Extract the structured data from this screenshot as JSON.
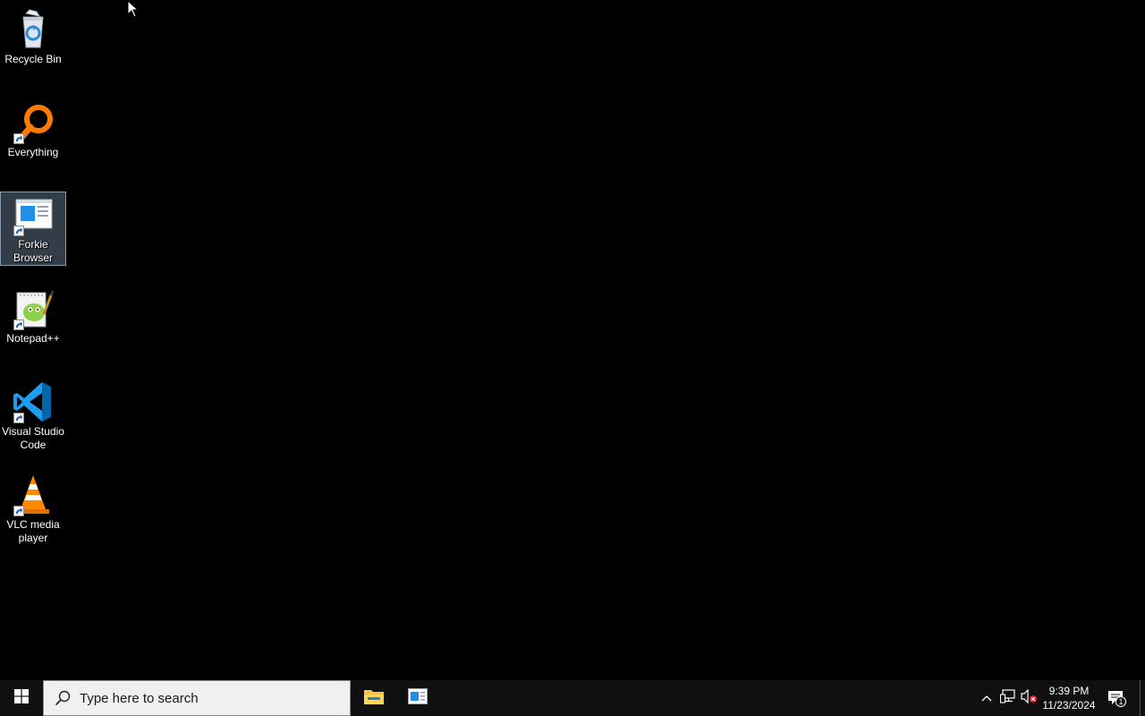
{
  "desktop": {
    "icons": [
      {
        "label": "Recycle Bin",
        "icon": "recycle-bin-icon"
      },
      {
        "label": "Everything",
        "icon": "everything-search-icon"
      },
      {
        "label": "Forkie Browser",
        "icon": "forkie-browser-icon",
        "selected": true
      },
      {
        "label": "Notepad++",
        "icon": "notepad-plus-plus-icon"
      },
      {
        "label": "Visual Studio Code",
        "icon": "vscode-icon"
      },
      {
        "label": "VLC media player",
        "icon": "vlc-cone-icon"
      }
    ]
  },
  "taskbar": {
    "start_icon": "windows-logo-icon",
    "search_placeholder": "Type here to search",
    "pinned_apps": [
      {
        "name": "File Explorer",
        "icon": "folder-icon"
      },
      {
        "name": "Forkie Browser",
        "icon": "forkie-browser-icon"
      }
    ],
    "tray": {
      "overflow_icon": "chevron-up-icon",
      "network_icon": "network-icon",
      "volume_icon": "volume-muted-icon",
      "notification_count": "1"
    },
    "clock": {
      "time": "9:39 PM",
      "date": "11/23/2024"
    }
  },
  "colors": {
    "desktop_background": "#000000",
    "taskbar_background": "#101010",
    "selection": "#6e87a0"
  }
}
